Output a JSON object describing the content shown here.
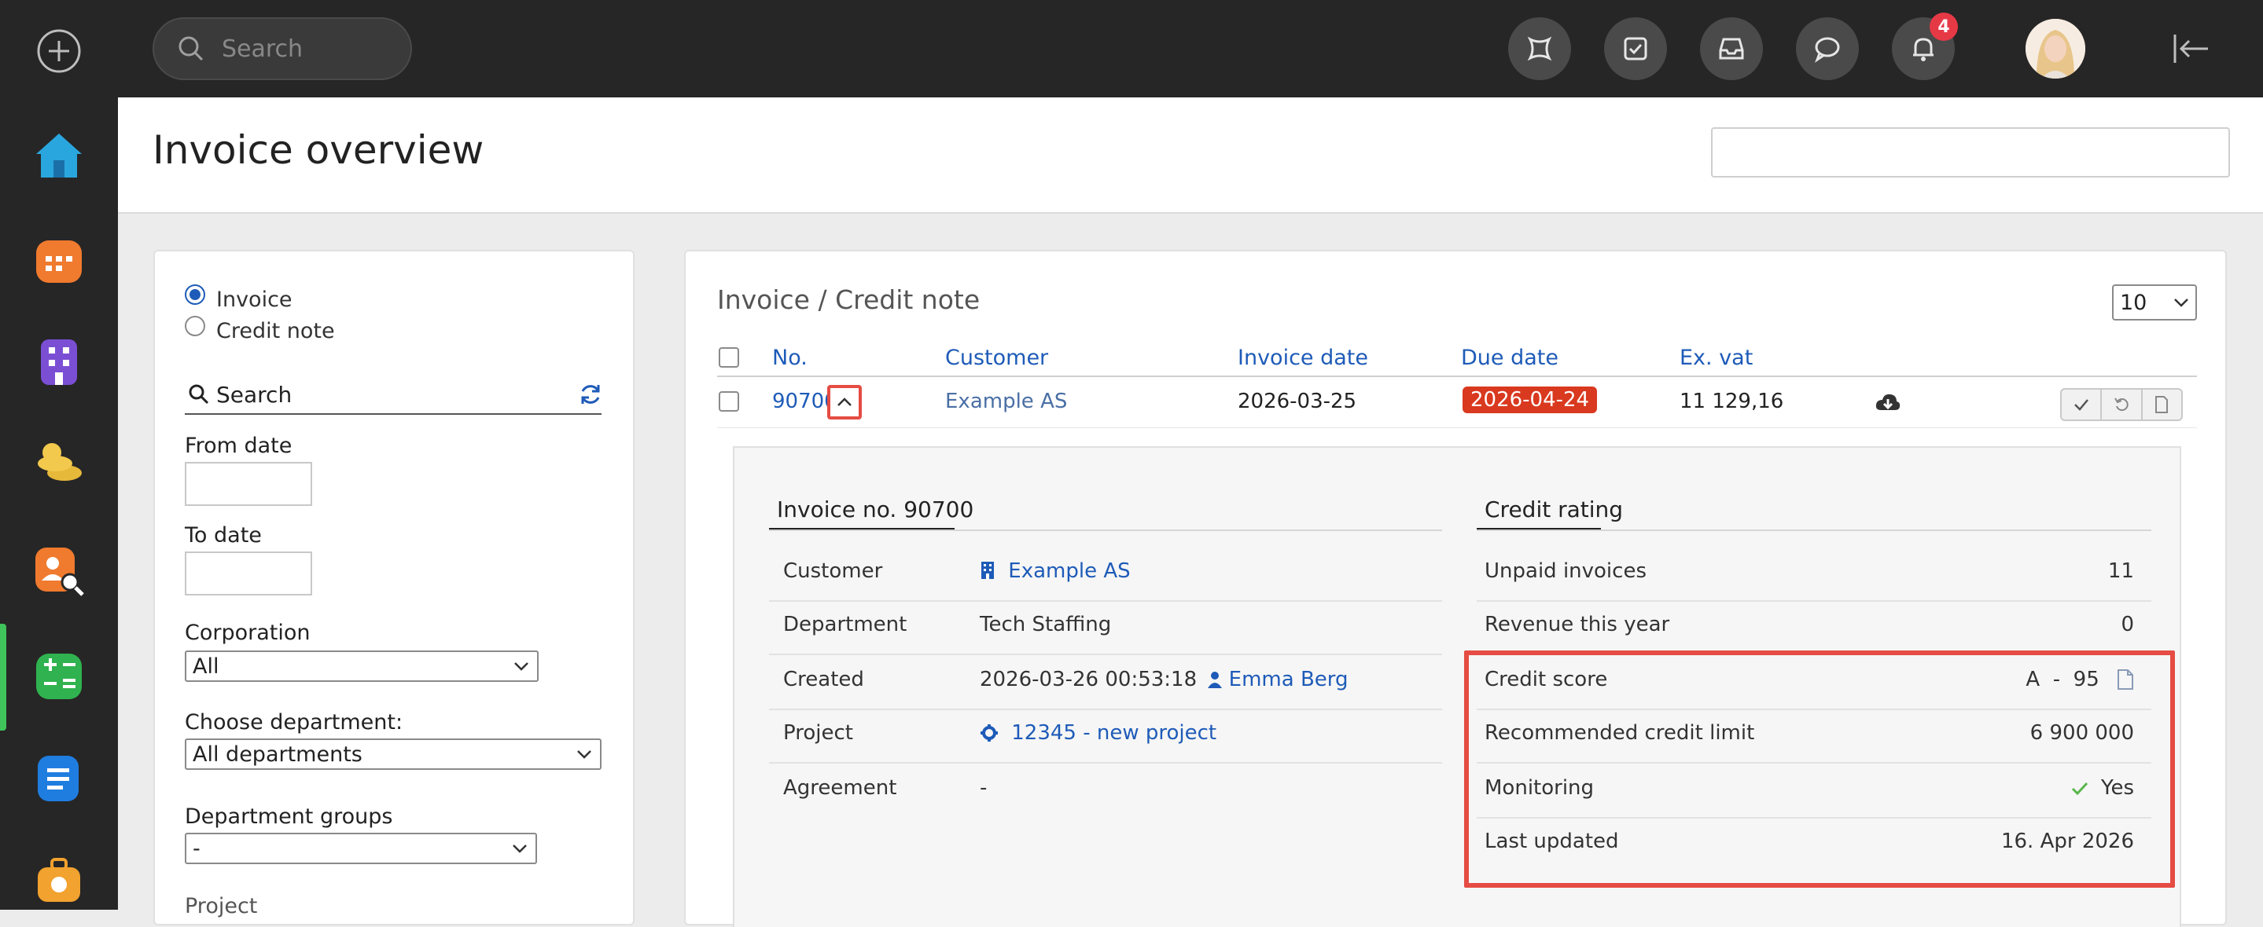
{
  "topbar": {
    "search_placeholder": "Search",
    "notification_count": "4",
    "icons": [
      "puzzle-icon",
      "checkbox-icon",
      "inbox-icon",
      "chat-icon",
      "bell-icon"
    ]
  },
  "rail": {
    "items": [
      "add-icon",
      "home-icon",
      "calendar-icon",
      "building-icon",
      "coins-icon",
      "person-search-icon",
      "spreadsheet-icon",
      "document-icon",
      "briefcase-clock-icon"
    ]
  },
  "page": {
    "title": "Invoice overview"
  },
  "filter": {
    "radio_invoice": "Invoice",
    "radio_credit": "Credit note",
    "search_label": "Search",
    "from_date": "From date",
    "to_date": "To date",
    "corporation_label": "Corporation",
    "corporation_value": "All",
    "department_label": "Choose department:",
    "department_value": "All departments",
    "dept_groups_label": "Department groups",
    "dept_groups_value": "-",
    "project_label": "Project"
  },
  "main": {
    "title": "Invoice / Credit note",
    "page_size": "10",
    "columns": [
      "No.",
      "Customer",
      "Invoice date",
      "Due date",
      "Ex. vat"
    ],
    "row": {
      "no": "90700",
      "customer": "Example AS",
      "invoice_date": "2026-03-25",
      "due_date": "2026-04-24",
      "ex_vat": "11 129,16"
    }
  },
  "invoice_details": {
    "title": "Invoice no. 90700",
    "rows": [
      {
        "label": "Customer",
        "value": "Example AS"
      },
      {
        "label": "Department",
        "value": "Tech Staffing"
      },
      {
        "label": "Created",
        "value": "2026-03-26 00:53:18",
        "user": "Emma Berg"
      },
      {
        "label": "Project",
        "value": "12345 - new project"
      },
      {
        "label": "Agreement",
        "value": "-"
      }
    ]
  },
  "credit_rating": {
    "title": "Credit rating",
    "rows": [
      {
        "label": "Unpaid invoices",
        "value": "11"
      },
      {
        "label": "Revenue this year",
        "value": "0"
      },
      {
        "label": "Credit score",
        "value": "A  -  95"
      },
      {
        "label": "Recommended credit limit",
        "value": "6 900 000"
      },
      {
        "label": "Monitoring",
        "value": "Yes"
      },
      {
        "label": "Last updated",
        "value": "16. Apr 2026"
      }
    ]
  },
  "colors": {
    "accent": "#1e5bb8",
    "due": "#d9391f",
    "highlight": "#e54c43",
    "rail": "#262626"
  }
}
